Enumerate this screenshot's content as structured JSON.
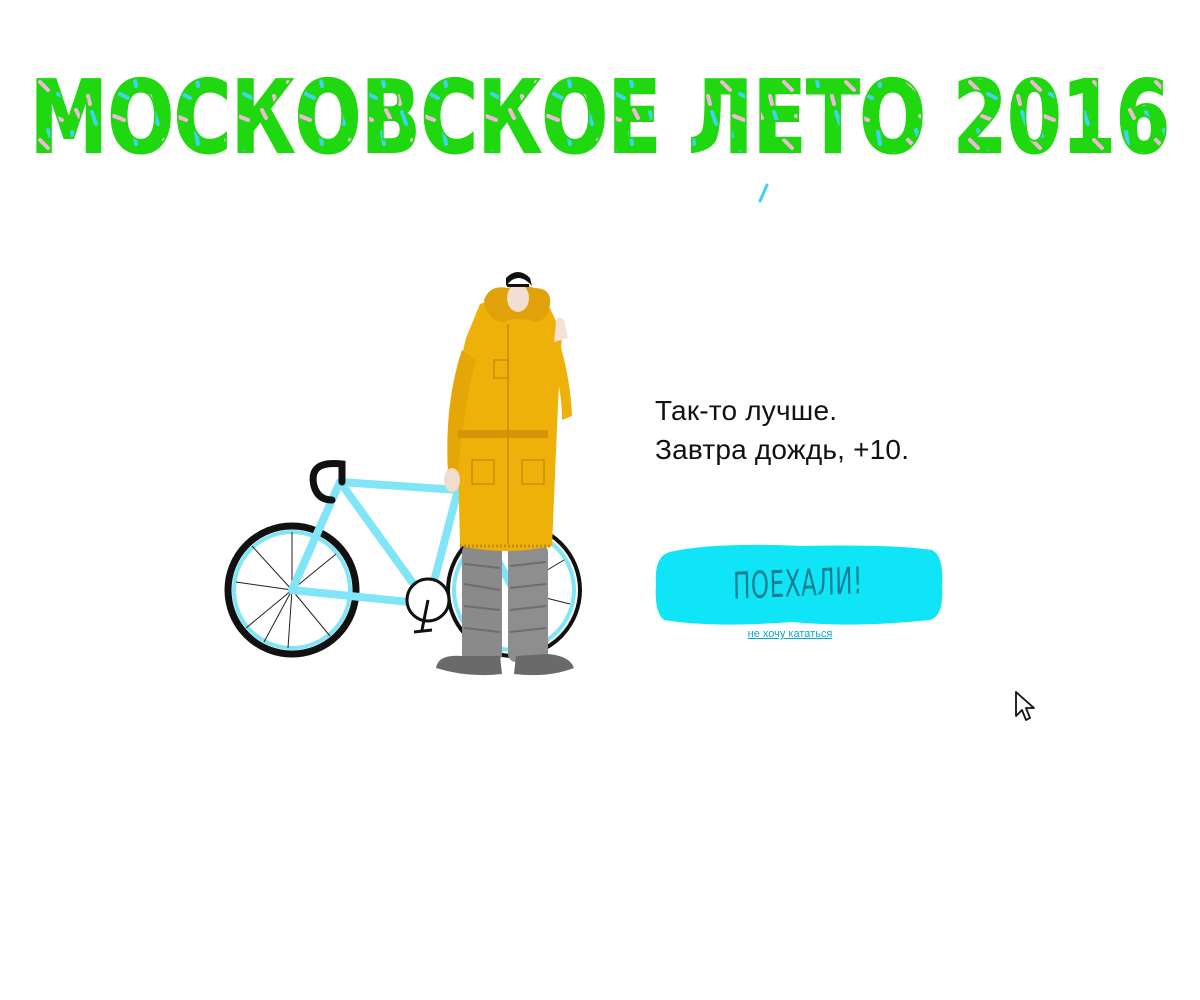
{
  "header": {
    "title": "МОСКОВСКОЕ ЛЕТО 2016"
  },
  "illustration": {
    "icon": "cyclist-with-bike-illustration"
  },
  "message": {
    "line1": "Так-то лучше.",
    "line2": "Завтра дождь, +10."
  },
  "actions": {
    "go_label": "ПОЕХАЛИ!",
    "skip_label": "не хочу кататься"
  },
  "colors": {
    "title_green": "#1fd80f",
    "sprinkle_cyan": "#3fd3f0",
    "sprinkle_pink": "#f2b8d8",
    "button_cyan": "#10e4f7",
    "button_text": "#157e93",
    "link": "#0aa7c9",
    "coat": "#edb10a",
    "bike_frame": "#7fe5f7"
  }
}
